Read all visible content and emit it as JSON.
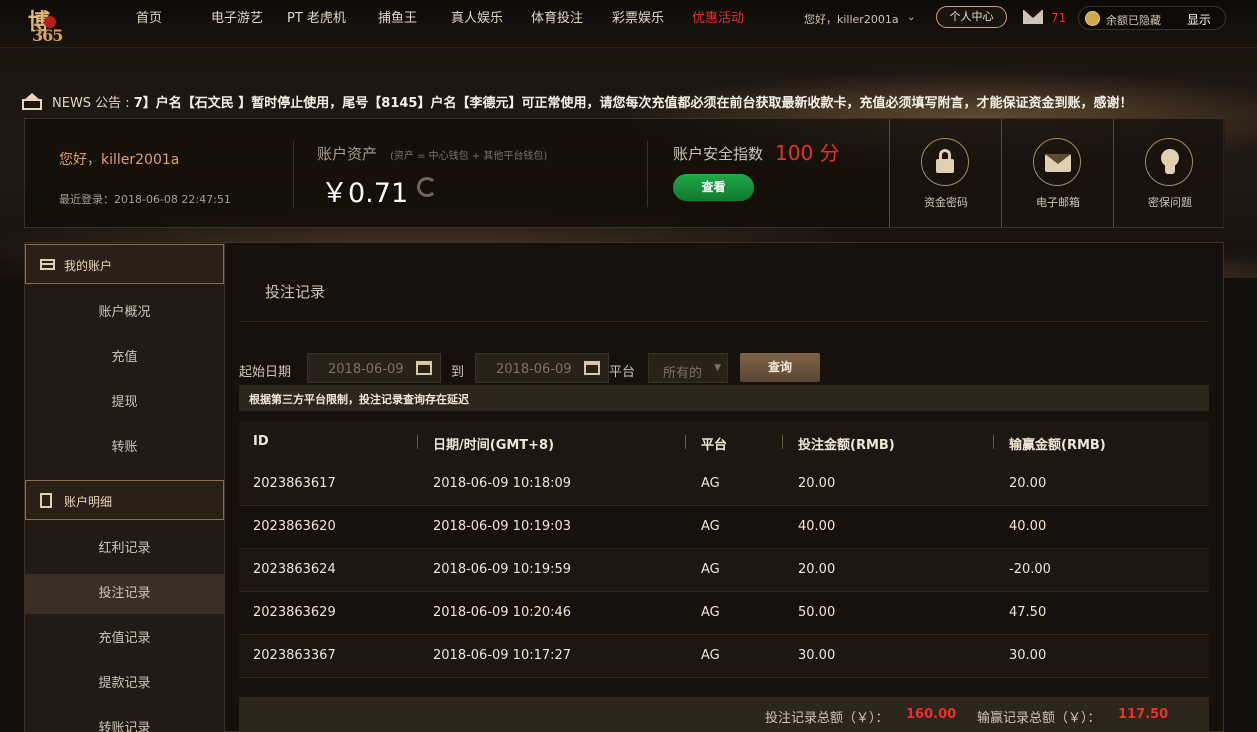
{
  "logo": {
    "line1": "博",
    "line2": "365"
  },
  "nav": {
    "items": [
      {
        "label": "首页",
        "active": false
      },
      {
        "label": "电子游艺",
        "active": false
      },
      {
        "label": "PT 老虎机",
        "active": false
      },
      {
        "label": "捕鱼王",
        "active": false
      },
      {
        "label": "真人娱乐",
        "active": false
      },
      {
        "label": "体育投注",
        "active": false
      },
      {
        "label": "彩票娱乐",
        "active": false
      },
      {
        "label": "优惠活动",
        "active": true
      }
    ],
    "user_greeting": "您好，killer2001a",
    "user_center": "个人中心",
    "mail_count": "71",
    "balance_hidden": "余额已隐藏",
    "show_label": "显示"
  },
  "news": {
    "label": "NEWS 公告 :",
    "text": "7】户名【石文民 】暂时停止使用，尾号【8145】户名【李德元】可正常使用，请您每次充值都必须在前台获取最新收款卡，充值必须填写附言，才能保证资金到账，感谢！"
  },
  "summary": {
    "greeting": "您好，killer2001a",
    "last_login": "最近登录：2018-06-08 22:47:51",
    "assets_title": "账户资产",
    "assets_note": "(资产 = 中心钱包 + 其他平台钱包)",
    "assets_value": "￥0.71",
    "security_title": "账户安全指数",
    "security_score": "100 分",
    "view_button": "查看",
    "security_items": [
      "资金密码",
      "电子邮箱",
      "密保问题"
    ]
  },
  "sidebar": {
    "my_account": "我的账户",
    "account_items": [
      "账户概况",
      "充值",
      "提现",
      "转账"
    ],
    "details": "账户明细",
    "detail_items": [
      "红利记录",
      "投注记录",
      "充值记录",
      "提款记录",
      "转账记录"
    ],
    "active_item": "投注记录"
  },
  "main": {
    "title": "投注记录",
    "filter": {
      "start_label": "起始日期",
      "start_date": "2018-06-09",
      "to_label": "到",
      "end_date": "2018-06-09",
      "platform_label": "平台",
      "platform_value": "所有的",
      "query_button": "查询"
    },
    "notice": "根据第三方平台限制，投注记录查询存在延迟",
    "table": {
      "headers": [
        "ID",
        "日期/时间(GMT+8)",
        "平台",
        "投注金额(RMB)",
        "输赢金额(RMB)"
      ],
      "rows": [
        [
          "2023863617",
          "2018-06-09 10:18:09",
          "AG",
          "20.00",
          "20.00"
        ],
        [
          "2023863620",
          "2018-06-09 10:19:03",
          "AG",
          "40.00",
          "40.00"
        ],
        [
          "2023863624",
          "2018-06-09 10:19:59",
          "AG",
          "20.00",
          "-20.00"
        ],
        [
          "2023863629",
          "2018-06-09 10:20:46",
          "AG",
          "50.00",
          "47.50"
        ],
        [
          "2023863367",
          "2018-06-09 10:17:27",
          "AG",
          "30.00",
          "30.00"
        ]
      ]
    },
    "footer": {
      "bet_total_label": "投注记录总额（￥）：",
      "bet_total": "160.00",
      "win_total_label": "输赢记录总额（￥）：",
      "win_total": "117.50"
    }
  },
  "colors": {
    "accent_red": "#e8312a",
    "gold": "#c9a46a",
    "green": "#1fa84a"
  }
}
